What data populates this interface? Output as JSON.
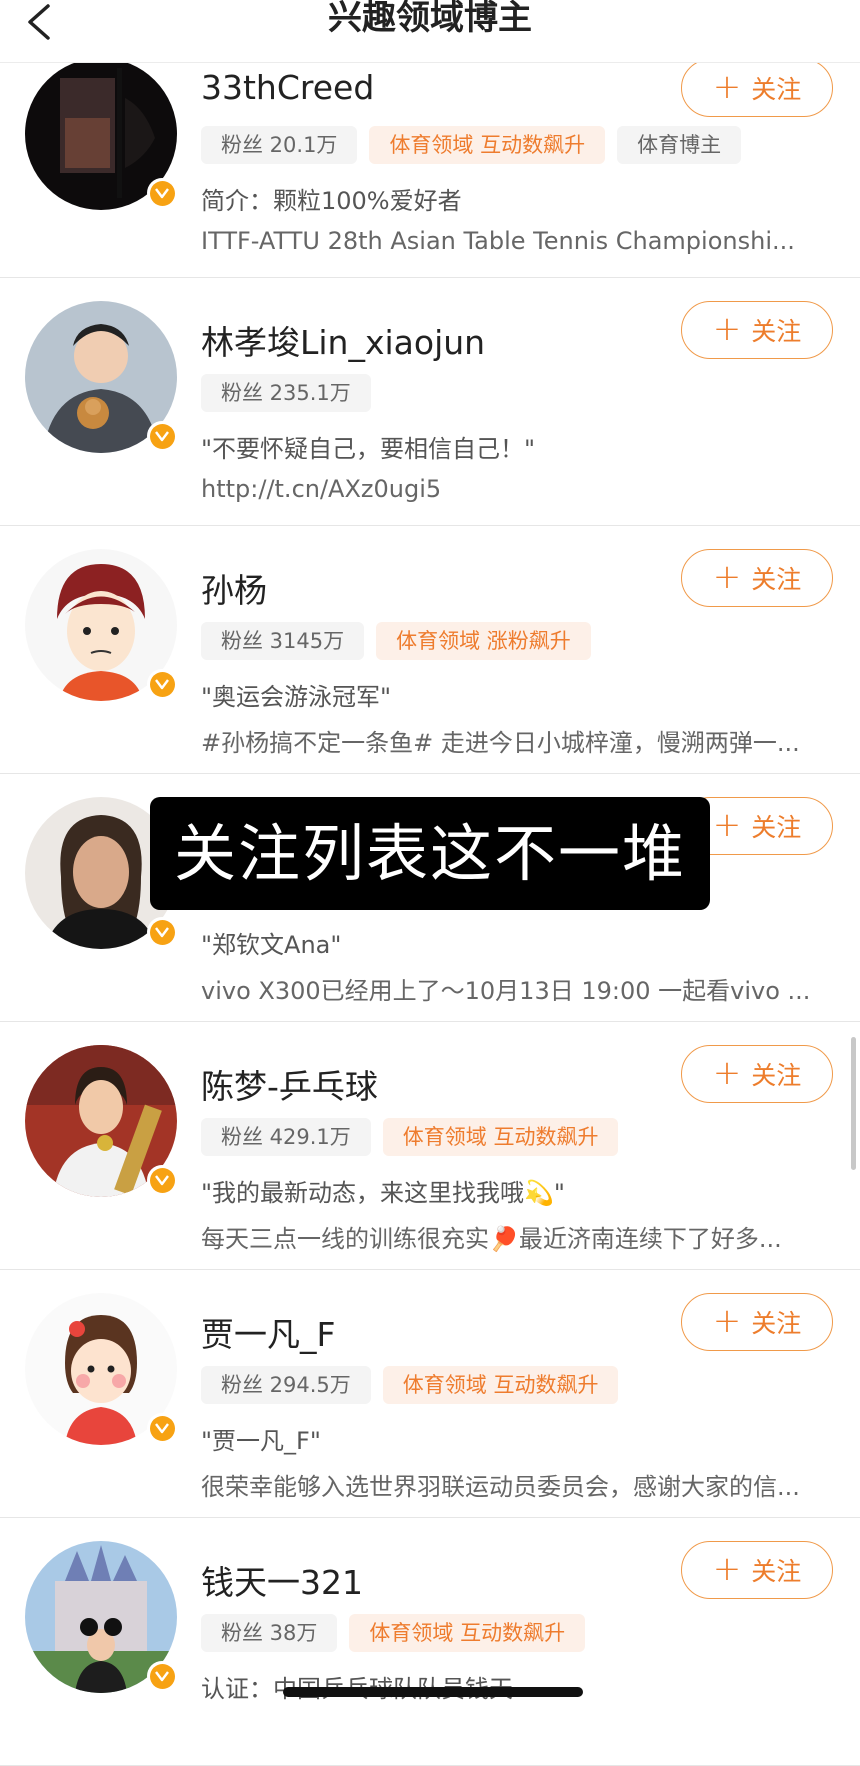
{
  "header": {
    "title": "兴趣领域博主"
  },
  "colors": {
    "accent": "#ed7d2c",
    "tag_orange_bg": "#fdf0e8",
    "verified": "#f7a213"
  },
  "overlay": {
    "caption": "关注列表这不一堆"
  },
  "follow_label": "关注",
  "users": [
    {
      "name": "33thCreed",
      "fans": "粉丝 20.1万",
      "tags": [
        "体育领域 互动数飙升"
      ],
      "extra_tag": "体育博主",
      "desc1": "简介：颗粒100%爱好者",
      "desc2": "ITTF-ATTU 28th Asian Table Tennis Championshi..."
    },
    {
      "name": "林孝埈Lin_xiaojun",
      "fans": "粉丝 235.1万",
      "tags": [],
      "extra_tag": "",
      "desc1": "\"不要怀疑自己，要相信自己！\"",
      "desc2": "http://t.cn/AXz0ugi5"
    },
    {
      "name": "孙杨",
      "fans": "粉丝 3145万",
      "tags": [
        "体育领域 涨粉飙升"
      ],
      "extra_tag": "",
      "desc1": "\"奥运会游泳冠军\"",
      "desc2": "#孙杨搞不定一条鱼# 走进今日小城梓潼，慢溯两弹一..."
    },
    {
      "name": "",
      "fans": "",
      "tags": [],
      "extra_tag": "",
      "desc1": "\"郑钦文Ana\"",
      "desc2": "vivo X300已经用上了～10月13日 19:00 一起看vivo ..."
    },
    {
      "name": "陈梦-乒乓球",
      "fans": "粉丝 429.1万",
      "tags": [
        "体育领域 互动数飙升"
      ],
      "extra_tag": "",
      "desc1": "\"我的最新动态，来这里找我哦💫\"",
      "desc2": "每天三点一线的训练很充实🏓最近济南连续下了好多..."
    },
    {
      "name": "贾一凡_F",
      "fans": "粉丝 294.5万",
      "tags": [
        "体育领域 互动数飙升"
      ],
      "extra_tag": "",
      "desc1": "\"贾一凡_F\"",
      "desc2": "很荣幸能够入选世界羽联运动员委员会，感谢大家的信..."
    },
    {
      "name": "钱天一321",
      "fans": "粉丝 38万",
      "tags": [
        "体育领域 互动数飙升"
      ],
      "extra_tag": "",
      "desc1": "认证：中国乒乓球队队员钱天一",
      "desc2": ""
    }
  ]
}
